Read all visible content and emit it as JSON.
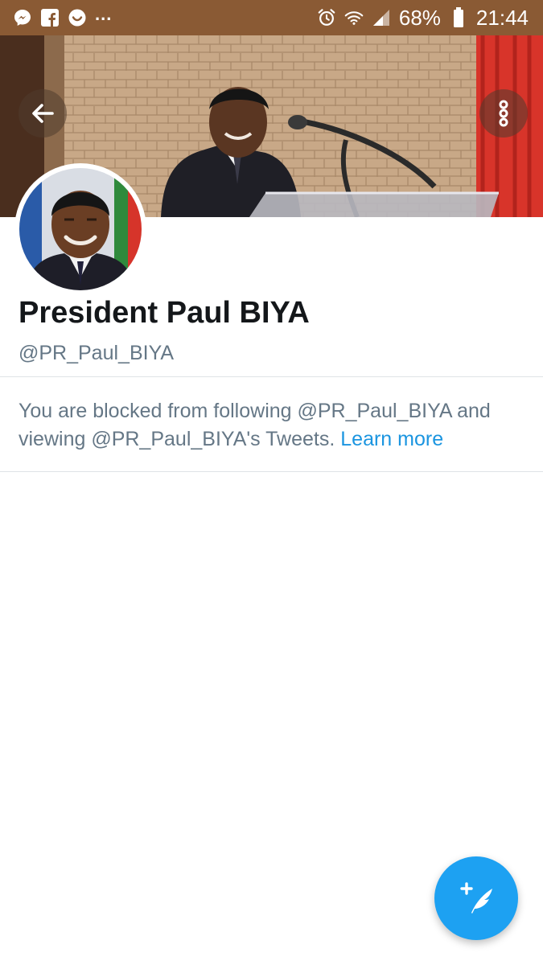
{
  "status_bar": {
    "notification_icons": [
      "messenger-icon",
      "facebook-icon",
      "app-notification-icon"
    ],
    "more_notifications": "...",
    "battery_percent": "68%",
    "time": "21:44",
    "system_icons": [
      "alarm-icon",
      "wifi-icon",
      "signal-icon",
      "battery-icon"
    ]
  },
  "header": {
    "back_icon": "arrow-left-icon",
    "more_icon": "vertical-dots-icon"
  },
  "profile": {
    "display_name": "President Paul BIYA",
    "handle": "@PR_Paul_BIYA"
  },
  "notice": {
    "blocked_text": "You are blocked from following @PR_Paul_BIYA and viewing @PR_Paul_BIYA's Tweets.",
    "learn_more": "Learn more"
  },
  "fab": {
    "icon": "compose-tweet-icon"
  },
  "colors": {
    "status_bar": "#8a5a34",
    "accent": "#1da1f2",
    "link": "#1b95e0",
    "secondary_text": "#657786",
    "primary_text": "#14171a"
  }
}
